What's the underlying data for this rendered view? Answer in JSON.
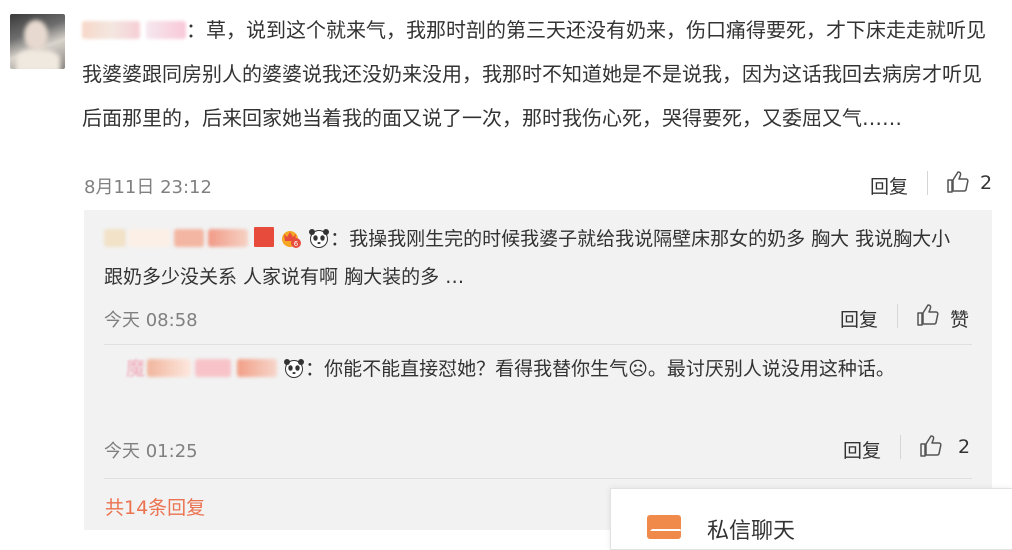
{
  "main_comment": {
    "text": "：草，说到这个就来气，我那时剖的第三天还没有奶来，伤口痛得要死，才下床走走就听见我婆婆跟同房别人的婆婆说我还没奶来没用，我那时不知道她是不是说我，因为这话我回去病房才听见后面那里的，后来回家她当着我的面又说了一次，那时我伤心死，哭得要死，又委屈又气……",
    "timestamp": "8月11日 23:12",
    "reply_label": "回复",
    "like_count": "2"
  },
  "replies": [
    {
      "text": "：我操我刚生完的时候我婆子就给我说隔壁床那女的奶多  胸大   我说胸大小跟奶多少没关系  人家说有啊   胸大装的多  …",
      "timestamp": "今天 08:58",
      "reply_label": "回复",
      "like_label": "赞"
    },
    {
      "text": "：你能不能直接怼她？看得我替你生气☹。最讨厌别人说没用这种话。",
      "name_prefix": "魔",
      "timestamp": "今天 01:25",
      "reply_label": "回复",
      "like_count": "2"
    }
  ],
  "more_replies": "共14条回复",
  "chat_panel": {
    "label": "私信聊天"
  },
  "colors": {
    "accent": "#eb7350",
    "meta": "#808080",
    "reply_bg": "#f2f2f2"
  }
}
